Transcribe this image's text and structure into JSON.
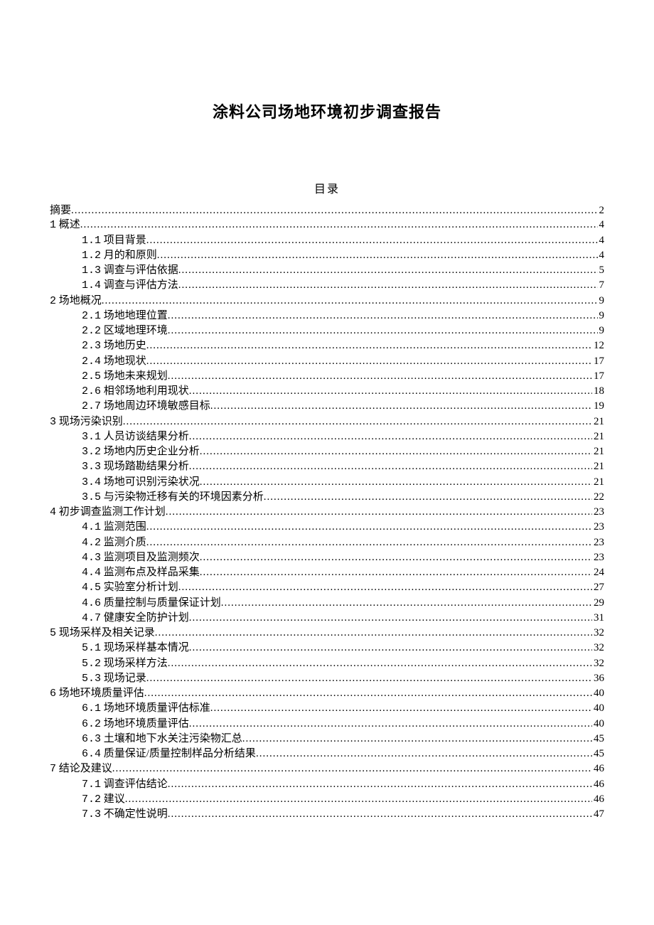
{
  "title": "涂料公司场地环境初步调查报告",
  "toc_heading": "目录",
  "toc": [
    {
      "level": 0,
      "num": "",
      "label": "摘要",
      "page": "2"
    },
    {
      "level": 0,
      "num": "1",
      "label": "概述",
      "page": "4"
    },
    {
      "level": 1,
      "num": "1.1",
      "label": "项目背景",
      "page": "4"
    },
    {
      "level": 1,
      "num": "1.2",
      "label": "月的和原则",
      "page": "4"
    },
    {
      "level": 1,
      "num": "1.3",
      "label": "调查与评估依据",
      "page": "5"
    },
    {
      "level": 1,
      "num": "1.4",
      "label": "调查与评估方法",
      "page": "7"
    },
    {
      "level": 0,
      "num": "2",
      "label": "场地概况",
      "page": "9"
    },
    {
      "level": 1,
      "num": "2.1",
      "label": "场地地理位置",
      "page": "9"
    },
    {
      "level": 1,
      "num": "2.2",
      "label": "区域地理环境",
      "page": "9"
    },
    {
      "level": 1,
      "num": "2.3",
      "label": "场地历史",
      "page": "12"
    },
    {
      "level": 1,
      "num": "2.4",
      "label": "场地现状",
      "page": "17"
    },
    {
      "level": 1,
      "num": "2.5",
      "label": "场地未来规划",
      "page": "17"
    },
    {
      "level": 1,
      "num": "2.6",
      "label": "相邻场地利用现状",
      "page": "18"
    },
    {
      "level": 1,
      "num": "2.7",
      "label": "场地周边环境敏感目标",
      "page": "19"
    },
    {
      "level": 0,
      "num": "3",
      "label": "现场污染识别",
      "page": "21"
    },
    {
      "level": 1,
      "num": "3.1",
      "label": "人员访谈结果分析",
      "page": "21"
    },
    {
      "level": 1,
      "num": "3.2",
      "label": "场地内历史企业分析",
      "page": "21"
    },
    {
      "level": 1,
      "num": "3.3",
      "label": "现场踏勘结果分析",
      "page": "21"
    },
    {
      "level": 1,
      "num": "3.4",
      "label": "场地可识别污染状况",
      "page": "21"
    },
    {
      "level": 1,
      "num": "3.5",
      "label": "与污染物迁移有关的环境因素分析",
      "page": "22"
    },
    {
      "level": 0,
      "num": "4",
      "label": "初步调查监测工作计划",
      "page": "23"
    },
    {
      "level": 1,
      "num": "4.1",
      "label": "监测范围",
      "page": "23"
    },
    {
      "level": 1,
      "num": "4.2",
      "label": "监测介质",
      "page": "23"
    },
    {
      "level": 1,
      "num": "4.3",
      "label": "监测项目及监测频次",
      "page": "23"
    },
    {
      "level": 1,
      "num": "4.4",
      "label": "监测布点及样品采集",
      "page": "24"
    },
    {
      "level": 1,
      "num": "4.5",
      "label": "实验室分析计划",
      "page": "27"
    },
    {
      "level": 1,
      "num": "4.6",
      "label": "质量控制与质量保证计划",
      "page": "29"
    },
    {
      "level": 1,
      "num": "4.7",
      "label": "健康安全防护计划",
      "page": "31"
    },
    {
      "level": 0,
      "num": "5",
      "label": "现场采样及相关记录",
      "page": "32"
    },
    {
      "level": 1,
      "num": "5.1",
      "label": "现场采样基本情况",
      "page": "32"
    },
    {
      "level": 1,
      "num": "5.2",
      "label": "现场采样方法",
      "page": "32"
    },
    {
      "level": 1,
      "num": "5.3",
      "label": "现场记录",
      "page": "36"
    },
    {
      "level": 0,
      "num": "6",
      "label": "场地环境质量评估",
      "page": "40"
    },
    {
      "level": 1,
      "num": "6.1",
      "label": "场地环境质量评估标准",
      "page": "40"
    },
    {
      "level": 1,
      "num": "6.2",
      "label": "场地环境质量评估",
      "page": "40"
    },
    {
      "level": 1,
      "num": "6.3",
      "label": "土壤和地下水关注污染物汇总",
      "page": "45"
    },
    {
      "level": 1,
      "num": "6.4",
      "label": "质量保证/质量控制样品分析结果",
      "page": "45"
    },
    {
      "level": 0,
      "num": "7",
      "label": "结论及建议",
      "page": "46"
    },
    {
      "level": 1,
      "num": "7.1",
      "label": "调查评估结论",
      "page": "46"
    },
    {
      "level": 1,
      "num": "7.2",
      "label": "建议",
      "page": "46"
    },
    {
      "level": 1,
      "num": "7.3",
      "label": "不确定性说明",
      "page": "47"
    }
  ]
}
